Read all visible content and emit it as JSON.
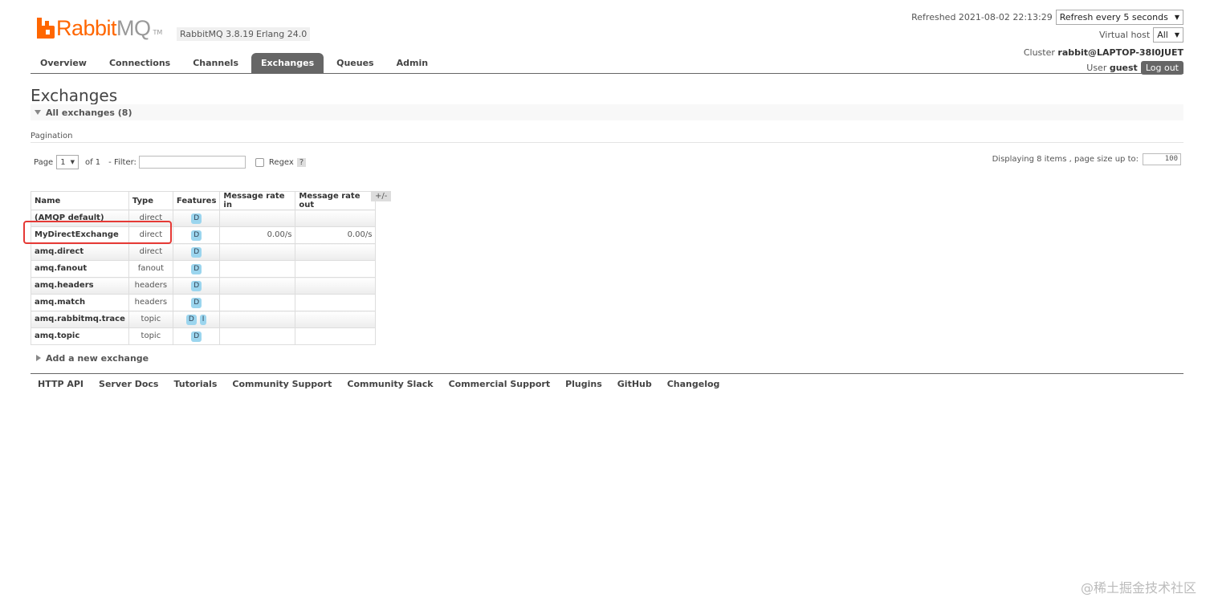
{
  "header": {
    "logo_rabbit": "Rabbit",
    "logo_mq": "MQ",
    "logo_tm": "TM",
    "rabbitmq_version": "RabbitMQ 3.8.19",
    "erlang_version": "Erlang 24.0",
    "refreshed_label": "Refreshed 2021-08-02 22:13:29",
    "refresh_select": "Refresh every 5 seconds",
    "virtual_host_label": "Virtual host",
    "virtual_host_select": "All",
    "cluster_label": "Cluster",
    "cluster_name": "rabbit@LAPTOP-38I0JUET",
    "user_label": "User",
    "user_name": "guest",
    "logout": "Log out"
  },
  "tabs": [
    "Overview",
    "Connections",
    "Channels",
    "Exchanges",
    "Queues",
    "Admin"
  ],
  "active_tab": "Exchanges",
  "page_title": "Exchanges",
  "section_title": "All exchanges (8)",
  "pagination": {
    "label": "Pagination",
    "page_label": "Page",
    "page_value": "1",
    "of_label": "of 1",
    "filter_label": "- Filter:",
    "regex_label": "Regex",
    "help": "?",
    "displaying": "Displaying 8 items , page size up to:",
    "page_size": "100"
  },
  "table": {
    "headers": [
      "Name",
      "Type",
      "Features",
      "Message rate in",
      "Message rate out"
    ],
    "toggle": "+/-",
    "rows": [
      {
        "name": "(AMQP default)",
        "type": "direct",
        "features": [
          "D"
        ],
        "rate_in": "",
        "rate_out": ""
      },
      {
        "name": "MyDirectExchange",
        "type": "direct",
        "features": [
          "D"
        ],
        "rate_in": "0.00/s",
        "rate_out": "0.00/s"
      },
      {
        "name": "amq.direct",
        "type": "direct",
        "features": [
          "D"
        ],
        "rate_in": "",
        "rate_out": ""
      },
      {
        "name": "amq.fanout",
        "type": "fanout",
        "features": [
          "D"
        ],
        "rate_in": "",
        "rate_out": ""
      },
      {
        "name": "amq.headers",
        "type": "headers",
        "features": [
          "D"
        ],
        "rate_in": "",
        "rate_out": ""
      },
      {
        "name": "amq.match",
        "type": "headers",
        "features": [
          "D"
        ],
        "rate_in": "",
        "rate_out": ""
      },
      {
        "name": "amq.rabbitmq.trace",
        "type": "topic",
        "features": [
          "D",
          "I"
        ],
        "rate_in": "",
        "rate_out": ""
      },
      {
        "name": "amq.topic",
        "type": "topic",
        "features": [
          "D"
        ],
        "rate_in": "",
        "rate_out": ""
      }
    ]
  },
  "add_exchange": "Add a new exchange",
  "footer_links": [
    "HTTP API",
    "Server Docs",
    "Tutorials",
    "Community Support",
    "Community Slack",
    "Commercial Support",
    "Plugins",
    "GitHub",
    "Changelog"
  ],
  "watermark": "@稀土掘金技术社区",
  "colors": {
    "brand": "#ff6600",
    "tab_active": "#666666",
    "badge": "#9bd5ee",
    "highlight": "#e53935"
  }
}
